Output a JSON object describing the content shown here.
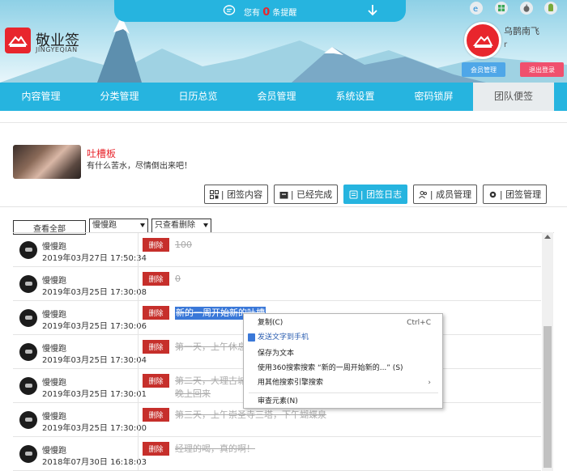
{
  "app": {
    "name_cn": "敬业签",
    "name_en": "JINGYEQIAN"
  },
  "notice": {
    "prefix": "您有",
    "count": "0",
    "suffix": "条提醒"
  },
  "user": {
    "name": "乌鹊南飞",
    "sub": "r",
    "member_button": "会员管理",
    "logout_button": "退出登录"
  },
  "nav": {
    "items": [
      "内容管理",
      "分类管理",
      "日历总览",
      "会员管理",
      "系统设置",
      "密码锁屏",
      "团队便签"
    ],
    "active_index": 6
  },
  "board": {
    "title": "吐槽板",
    "desc": "有什么苦水，尽情倒出来吧！"
  },
  "toolbar": {
    "content": "| 团签内容",
    "done": "| 已经完成",
    "log": "| 团签日志",
    "members": "| 成员管理",
    "manage": "| 团签管理"
  },
  "filters": {
    "view_all": "查看全部",
    "user_select": "慢慢跑",
    "type_select": "只查看删除"
  },
  "rows": [
    {
      "name": "慢慢跑",
      "date": "2019年03月27日 17:50:34",
      "del": "删除",
      "content": "100"
    },
    {
      "name": "慢慢跑",
      "date": "2019年03月25日 17:30:08",
      "del": "删除",
      "content": "0"
    },
    {
      "name": "慢慢跑",
      "date": "2019年03月25日 17:30:06",
      "del": "删除",
      "content": "新的一周开始新的吐槽"
    },
    {
      "name": "慢慢跑",
      "date": "2019年03月25日 17:30:04",
      "del": "删除",
      "content": "第一天，上午休息"
    },
    {
      "name": "慢慢跑",
      "date": "2019年03月25日 17:30:01",
      "del": "删除",
      "content": "第二天，大理古城"
    },
    {
      "name": "慢慢跑",
      "date": "2019年03月25日 17:30:00",
      "del": "删除",
      "content": "第三天，上午崇圣寺三塔，下午蝴蝶泉"
    },
    {
      "name": "慢慢跑",
      "date": "2018年07月30日 16:18:03",
      "del": "删除",
      "content": "经理的喝，真的啊！"
    }
  ],
  "row_extra": {
    "line2": "晚上回来"
  },
  "context_menu": {
    "copy": "复制(C)",
    "copy_shortcut": "Ctrl+C",
    "send_sms": "发送文字到手机",
    "save_text": "保存为文本",
    "search_360": "使用360搜索搜索 “新的一周开始新的...” (S)",
    "search_other": "用其他搜索引擎搜索",
    "inspect": "审查元素(N)"
  },
  "colors": {
    "accent": "#26b4df",
    "brand_red": "#e8262d",
    "delete_red": "#c62f2b",
    "logout_pink": "#f0506e",
    "member_blue": "#4fa7e8"
  }
}
